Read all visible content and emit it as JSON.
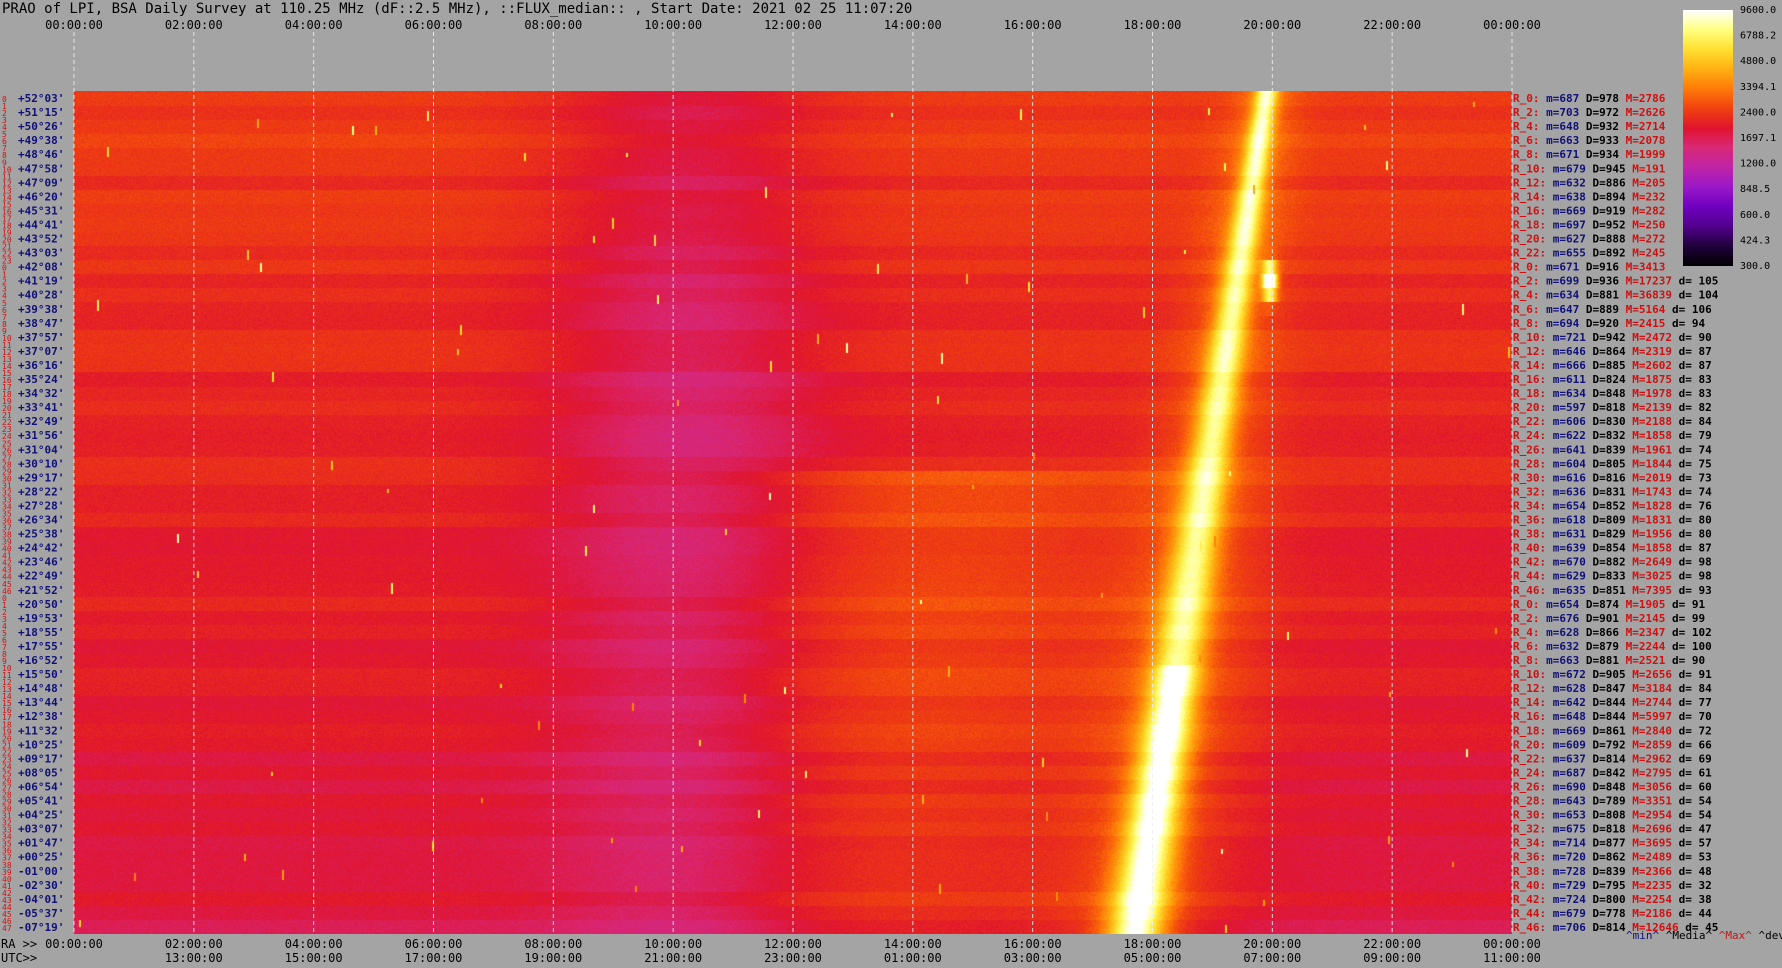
{
  "header": {
    "title": "PRAO of LPI, BSA Daily Survey at 110.25 MHz (dF::2.5 MHz), ::FLUX_median:: , Start Date: 2021 02 25 11:07:20"
  },
  "colors": {
    "background": "#a4a4a4",
    "text": "#000000",
    "label_red": "#d01010",
    "label_navy": "#101078",
    "grid": "#f0f0f0",
    "colormap": [
      "#000000",
      "#20003a",
      "#50008a",
      "#7000c0",
      "#9a18c8",
      "#c024a8",
      "#d82878",
      "#e0142e",
      "#f04010",
      "#ff7a08",
      "#ffb012",
      "#ffe030",
      "#ffff80",
      "#ffffff"
    ]
  },
  "chart_data": {
    "type": "heatmap",
    "title": "PRAO of LPI, BSA Daily Survey at 110.25 MHz (dF::2.5 MHz), ::FLUX_median:: , Start Date: 2021 02 25 11:07:20",
    "x_top_ticks": [
      "00:00:00",
      "02:00:00",
      "04:00:00",
      "06:00:00",
      "08:00:00",
      "10:00:00",
      "12:00:00",
      "14:00:00",
      "16:00:00",
      "18:00:00",
      "20:00:00",
      "22:00:00",
      "00:00:00"
    ],
    "x_bottom_ra_prefix": "RA >>",
    "x_bottom_ra_ticks": [
      "00:00:00",
      "02:00:00",
      "04:00:00",
      "06:00:00",
      "08:00:00",
      "10:00:00",
      "12:00:00",
      "14:00:00",
      "16:00:00",
      "18:00:00",
      "20:00:00",
      "22:00:00",
      "00:00:00"
    ],
    "x_bottom_utc_prefix": "UTC>>",
    "x_bottom_utc_ticks": [
      "13:00:00",
      "15:00:00",
      "17:00:00",
      "19:00:00",
      "21:00:00",
      "23:00:00",
      "01:00:00",
      "03:00:00",
      "05:00:00",
      "07:00:00",
      "09:00:00",
      "11:00:00"
    ],
    "beam_numbers": [
      "0",
      "1",
      "2",
      "3",
      "4",
      "5",
      "6",
      "7",
      "8",
      "9",
      "10",
      "11",
      "12",
      "13",
      "14",
      "15",
      "16",
      "17",
      "18",
      "19",
      "20",
      "21",
      "22",
      "23",
      "0",
      "1",
      "2",
      "3",
      "4",
      "5",
      "6",
      "7",
      "8",
      "9",
      "10",
      "11",
      "12",
      "13",
      "14",
      "15",
      "16",
      "17",
      "18",
      "19",
      "20",
      "21",
      "22",
      "23",
      "24",
      "25",
      "26",
      "27",
      "28",
      "29",
      "30",
      "31",
      "32",
      "33",
      "34",
      "35",
      "36",
      "37",
      "38",
      "39",
      "40",
      "41",
      "42",
      "43",
      "44",
      "45",
      "46",
      "0",
      "1",
      "2",
      "3",
      "4",
      "5",
      "6",
      "7",
      "8",
      "9",
      "10",
      "11",
      "12",
      "13",
      "14",
      "15",
      "16",
      "17",
      "18",
      "19",
      "20",
      "21",
      "22",
      "23",
      "24",
      "25",
      "26",
      "27",
      "28",
      "29",
      "30",
      "31",
      "32",
      "33",
      "34",
      "35",
      "36",
      "37",
      "38",
      "39",
      "40",
      "41",
      "42",
      "43",
      "44",
      "45",
      "46",
      "47"
    ],
    "declinations": [
      "+52°03'",
      "+51°15'",
      "+50°26'",
      "+49°38'",
      "+48°46'",
      "+47°58'",
      "+47°09'",
      "+46°20'",
      "+45°31'",
      "+44°41'",
      "+43°52'",
      "+43°03'",
      "+42°08'",
      "+41°19'",
      "+40°28'",
      "+39°38'",
      "+38°47'",
      "+37°57'",
      "+37°07'",
      "+36°16'",
      "+35°24'",
      "+34°32'",
      "+33°41'",
      "+32°49'",
      "+31°56'",
      "+31°04'",
      "+30°10'",
      "+29°17'",
      "+28°22'",
      "+27°28'",
      "+26°34'",
      "+25°38'",
      "+24°42'",
      "+23°46'",
      "+22°49'",
      "+21°52'",
      "+20°50'",
      "+19°53'",
      "+18°55'",
      "+17°55'",
      "+16°52'",
      "+15°50'",
      "+14°48'",
      "+13°44'",
      "+12°38'",
      "+11°32'",
      "+10°25'",
      "+09°17'",
      "+08°05'",
      "+06°54'",
      "+05°41'",
      "+04°25'",
      "+03°07'",
      "+01°47'",
      "+00°25'",
      "-01°00'",
      "-02°30'",
      "-04°01'",
      "-05°37'",
      "-07°19'"
    ],
    "beam_stats": [
      {
        "label": "R_0:",
        "min": "687",
        "median": "978",
        "max": "2786",
        "dev": ""
      },
      {
        "label": "R_2:",
        "min": "703",
        "median": "972",
        "max": "2626",
        "dev": ""
      },
      {
        "label": "R_4:",
        "min": "648",
        "median": "932",
        "max": "2714",
        "dev": ""
      },
      {
        "label": "R_6:",
        "min": "663",
        "median": "933",
        "max": "2078",
        "dev": ""
      },
      {
        "label": "R_8:",
        "min": "671",
        "median": "934",
        "max": "1999",
        "dev": ""
      },
      {
        "label": "R_10:",
        "min": "679",
        "median": "945",
        "max": "191",
        "dev": ""
      },
      {
        "label": "R_12:",
        "min": "632",
        "median": "886",
        "max": "205",
        "dev": ""
      },
      {
        "label": "R_14:",
        "min": "638",
        "median": "894",
        "max": "232",
        "dev": ""
      },
      {
        "label": "R_16:",
        "min": "669",
        "median": "919",
        "max": "282",
        "dev": ""
      },
      {
        "label": "R_18:",
        "min": "697",
        "median": "952",
        "max": "250",
        "dev": ""
      },
      {
        "label": "R_20:",
        "min": "627",
        "median": "888",
        "max": "272",
        "dev": ""
      },
      {
        "label": "R_22:",
        "min": "655",
        "median": "892",
        "max": "245",
        "dev": ""
      },
      {
        "label": "R_0:",
        "min": "671",
        "median": "916",
        "max": "3413",
        "dev": ""
      },
      {
        "label": "R_2:",
        "min": "699",
        "median": "936",
        "max": "17237",
        "dev": "105"
      },
      {
        "label": "R_4:",
        "min": "634",
        "median": "881",
        "max": "36839",
        "dev": "104"
      },
      {
        "label": "R_6:",
        "min": "647",
        "median": "889",
        "max": "5164",
        "dev": "106"
      },
      {
        "label": "R_8:",
        "min": "694",
        "median": "920",
        "max": "2415",
        "dev": "94"
      },
      {
        "label": "R_10:",
        "min": "721",
        "median": "942",
        "max": "2472",
        "dev": "90"
      },
      {
        "label": "R_12:",
        "min": "646",
        "median": "864",
        "max": "2319",
        "dev": "87"
      },
      {
        "label": "R_14:",
        "min": "666",
        "median": "885",
        "max": "2602",
        "dev": "87"
      },
      {
        "label": "R_16:",
        "min": "611",
        "median": "824",
        "max": "1875",
        "dev": "83"
      },
      {
        "label": "R_18:",
        "min": "634",
        "median": "848",
        "max": "1978",
        "dev": "83"
      },
      {
        "label": "R_20:",
        "min": "597",
        "median": "818",
        "max": "2139",
        "dev": "82"
      },
      {
        "label": "R_22:",
        "min": "606",
        "median": "830",
        "max": "2188",
        "dev": "84"
      },
      {
        "label": "R_24:",
        "min": "622",
        "median": "832",
        "max": "1858",
        "dev": "79"
      },
      {
        "label": "R_26:",
        "min": "641",
        "median": "839",
        "max": "1961",
        "dev": "74"
      },
      {
        "label": "R_28:",
        "min": "604",
        "median": "805",
        "max": "1844",
        "dev": "75"
      },
      {
        "label": "R_30:",
        "min": "616",
        "median": "816",
        "max": "2019",
        "dev": "73"
      },
      {
        "label": "R_32:",
        "min": "636",
        "median": "831",
        "max": "1743",
        "dev": "74"
      },
      {
        "label": "R_34:",
        "min": "654",
        "median": "852",
        "max": "1828",
        "dev": "76"
      },
      {
        "label": "R_36:",
        "min": "618",
        "median": "809",
        "max": "1831",
        "dev": "80"
      },
      {
        "label": "R_38:",
        "min": "631",
        "median": "829",
        "max": "1956",
        "dev": "80"
      },
      {
        "label": "R_40:",
        "min": "639",
        "median": "854",
        "max": "1858",
        "dev": "87"
      },
      {
        "label": "R_42:",
        "min": "670",
        "median": "882",
        "max": "2649",
        "dev": "98"
      },
      {
        "label": "R_44:",
        "min": "629",
        "median": "833",
        "max": "3025",
        "dev": "98"
      },
      {
        "label": "R_46:",
        "min": "635",
        "median": "851",
        "max": "7395",
        "dev": "93"
      },
      {
        "label": "R_0:",
        "min": "654",
        "median": "874",
        "max": "1905",
        "dev": "91"
      },
      {
        "label": "R_2:",
        "min": "676",
        "median": "901",
        "max": "2145",
        "dev": "99"
      },
      {
        "label": "R_4:",
        "min": "628",
        "median": "866",
        "max": "2347",
        "dev": "102"
      },
      {
        "label": "R_6:",
        "min": "632",
        "median": "879",
        "max": "2244",
        "dev": "100"
      },
      {
        "label": "R_8:",
        "min": "663",
        "median": "881",
        "max": "2521",
        "dev": "90"
      },
      {
        "label": "R_10:",
        "min": "672",
        "median": "905",
        "max": "2656",
        "dev": "91"
      },
      {
        "label": "R_12:",
        "min": "628",
        "median": "847",
        "max": "3184",
        "dev": "84"
      },
      {
        "label": "R_14:",
        "min": "642",
        "median": "844",
        "max": "2744",
        "dev": "77"
      },
      {
        "label": "R_16:",
        "min": "648",
        "median": "844",
        "max": "5997",
        "dev": "70"
      },
      {
        "label": "R_18:",
        "min": "669",
        "median": "861",
        "max": "2840",
        "dev": "72"
      },
      {
        "label": "R_20:",
        "min": "609",
        "median": "792",
        "max": "2859",
        "dev": "66"
      },
      {
        "label": "R_22:",
        "min": "637",
        "median": "814",
        "max": "2962",
        "dev": "69"
      },
      {
        "label": "R_24:",
        "min": "687",
        "median": "842",
        "max": "2795",
        "dev": "61"
      },
      {
        "label": "R_26:",
        "min": "690",
        "median": "848",
        "max": "3056",
        "dev": "60"
      },
      {
        "label": "R_28:",
        "min": "643",
        "median": "789",
        "max": "3351",
        "dev": "54"
      },
      {
        "label": "R_30:",
        "min": "653",
        "median": "808",
        "max": "2954",
        "dev": "54"
      },
      {
        "label": "R_32:",
        "min": "675",
        "median": "818",
        "max": "2696",
        "dev": "47"
      },
      {
        "label": "R_34:",
        "min": "714",
        "median": "877",
        "max": "3695",
        "dev": "57"
      },
      {
        "label": "R_36:",
        "min": "720",
        "median": "862",
        "max": "2489",
        "dev": "53"
      },
      {
        "label": "R_38:",
        "min": "728",
        "median": "839",
        "max": "2366",
        "dev": "48"
      },
      {
        "label": "R_40:",
        "min": "729",
        "median": "795",
        "max": "2235",
        "dev": "32"
      },
      {
        "label": "R_42:",
        "min": "724",
        "median": "800",
        "max": "2254",
        "dev": "38"
      },
      {
        "label": "R_44:",
        "min": "679",
        "median": "778",
        "max": "2186",
        "dev": "44"
      },
      {
        "label": "R_46:",
        "min": "706",
        "median": "814",
        "max": "12646",
        "dev": "45"
      }
    ],
    "stats_legend": {
      "min": "^min^",
      "median": "^Media^",
      "max": "^Max^",
      "dev": "^devia^"
    },
    "colorbar": {
      "ticks": [
        "9600.0",
        "6788.2",
        "4800.0",
        "3394.1",
        "2400.0",
        "1697.1",
        "1200.0",
        "848.5",
        "600.0",
        "424.3",
        "300.0"
      ]
    },
    "features": {
      "ra_axis_hours": [
        0,
        24
      ],
      "bright_band_ra": [
        [
          19.9,
          5
        ],
        [
          17.7,
          60
        ]
      ],
      "dark_region_ra": [
        7.5,
        13.0
      ],
      "hot_spot": {
        "ra": 19.95,
        "dec_row": 13
      }
    },
    "grid": true
  }
}
